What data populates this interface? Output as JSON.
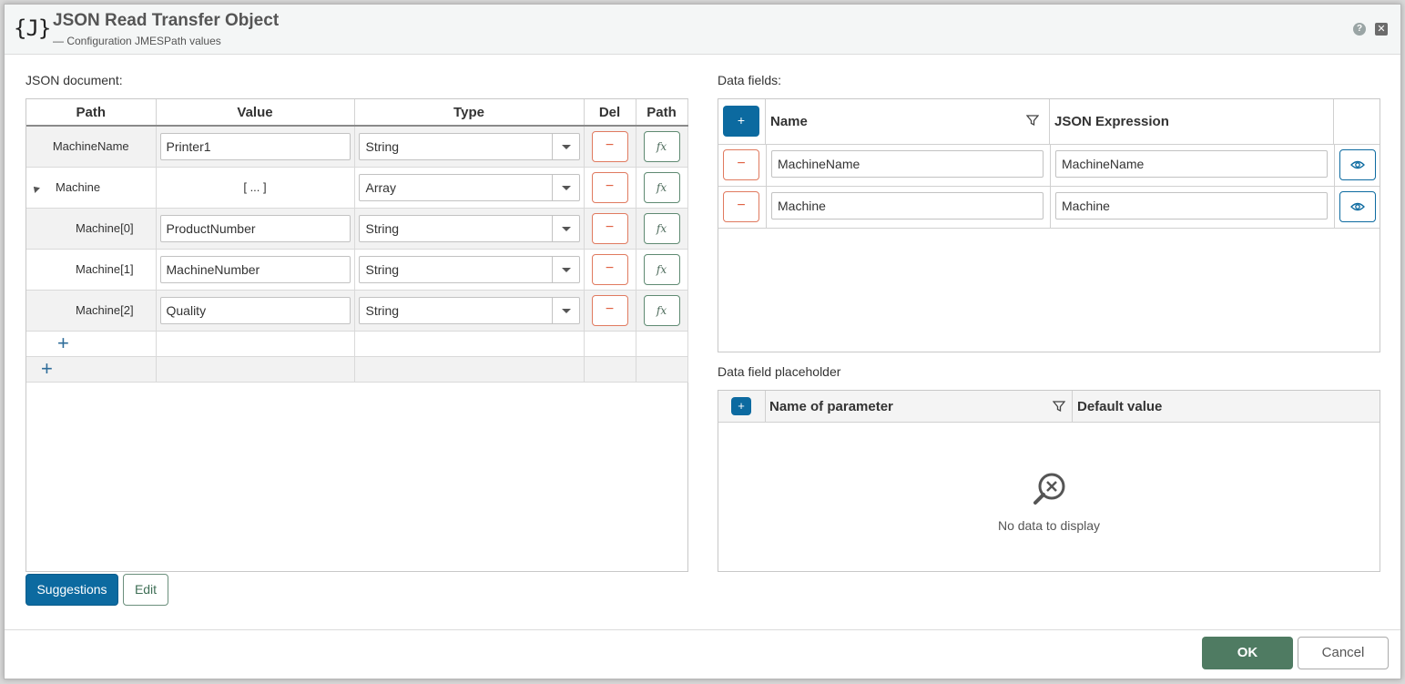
{
  "dialog": {
    "icon_text": "{J}",
    "title": "JSON Read Transfer Object",
    "subtitle": "— Configuration JMESPath values",
    "help_symbol": "?",
    "close_symbol": "✕"
  },
  "json_document": {
    "label": "JSON document:",
    "columns": [
      "Path",
      "Value",
      "Type",
      "Del",
      "Path"
    ],
    "rows": [
      {
        "path": "MachineName",
        "value": "Printer1",
        "type": "String"
      },
      {
        "path": "Machine",
        "value": "[ ... ]",
        "type": "Array"
      },
      {
        "path": "Machine[0]",
        "value": "ProductNumber",
        "type": "String"
      },
      {
        "path": "Machine[1]",
        "value": "MachineNumber",
        "type": "String"
      },
      {
        "path": "Machine[2]",
        "value": "Quality",
        "type": "String"
      }
    ],
    "del_symbol": "−",
    "fx_symbol": "fx",
    "add_symbol": "+"
  },
  "buttons": {
    "suggestions": "Suggestions",
    "edit": "Edit",
    "ok": "OK",
    "cancel": "Cancel"
  },
  "data_fields": {
    "label": "Data fields:",
    "add_symbol": "+",
    "columns": {
      "name": "Name",
      "expression": "JSON Expression"
    },
    "rows": [
      {
        "name": "MachineName",
        "expression": "MachineName"
      },
      {
        "name": "Machine",
        "expression": "Machine"
      }
    ]
  },
  "placeholder": {
    "label": "Data field placeholder",
    "add_symbol": "+",
    "columns": {
      "name": "Name of parameter",
      "default": "Default value"
    },
    "empty_text": "No data to display"
  },
  "colors": {
    "primary": "#0c6aa0",
    "ok": "#4f7b62",
    "delete": "#e06040"
  }
}
